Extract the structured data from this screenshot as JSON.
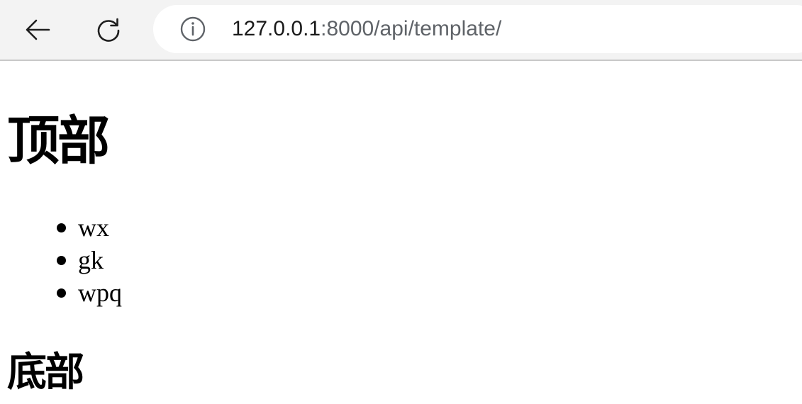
{
  "browser": {
    "address": {
      "host": "127.0.0.1",
      "rest": ":8000/api/template/"
    },
    "icons": {
      "back": "back-arrow-icon",
      "reload": "reload-icon",
      "info": "info-icon"
    }
  },
  "page": {
    "top_heading": "顶部",
    "list_items": [
      "wx",
      "gk",
      "wpq"
    ],
    "bottom_heading": "底部"
  }
}
